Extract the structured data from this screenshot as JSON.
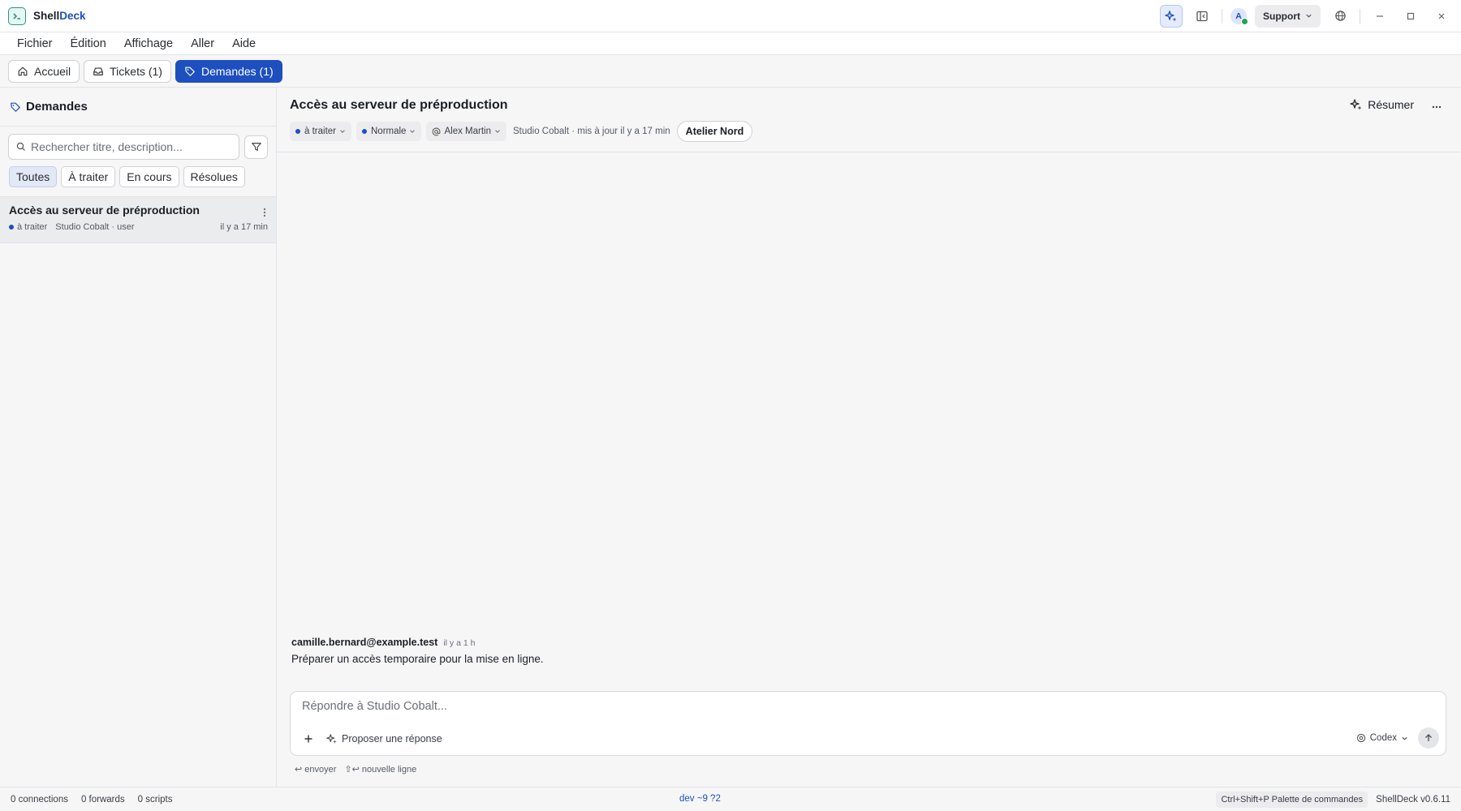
{
  "app": {
    "name_prefix": "Shell",
    "name_suffix": "Deck",
    "workspace": "Support",
    "avatar_initial": "A"
  },
  "menu": [
    "Fichier",
    "Édition",
    "Affichage",
    "Aller",
    "Aide"
  ],
  "tabs": [
    {
      "label": "Accueil",
      "icon": "home-icon"
    },
    {
      "label": "Tickets (1)",
      "icon": "inbox-icon"
    },
    {
      "label": "Demandes (1)",
      "icon": "tag-icon",
      "active": true
    }
  ],
  "sidebar": {
    "title": "Demandes",
    "search_placeholder": "Rechercher titre, description...",
    "filters": [
      "Toutes",
      "À traiter",
      "En cours",
      "Résolues"
    ],
    "active_filter": "Toutes",
    "items": [
      {
        "title": "Accès au serveur de préproduction",
        "status": "à traiter",
        "org": "Studio Cobalt · user",
        "time": "il y a 17 min"
      }
    ]
  },
  "ticket": {
    "title": "Accès au serveur de préproduction",
    "summarize_label": "Résumer",
    "status": "à traiter",
    "priority": "Normale",
    "assignee": "Alex Martin",
    "meta": "Studio Cobalt · mis à jour il y a 17 min",
    "org_button": "Atelier Nord",
    "messages": [
      {
        "author": "camille.bernard@example.test",
        "time": "il y a 1 h",
        "body": "Préparer un accès temporaire pour la mise en ligne."
      }
    ]
  },
  "composer": {
    "placeholder": "Répondre à Studio Cobalt...",
    "suggest_label": "Proposer une réponse",
    "model": "Codex",
    "hint_send": "↩ envoyer",
    "hint_newline": "⇧↩ nouvelle ligne"
  },
  "statusbar": {
    "connections": "0 connections",
    "forwards": "0 forwards",
    "scripts": "0 scripts",
    "branch": "dev ~9 ?2",
    "palette_hint": "Ctrl+Shift+P Palette de commandes",
    "version": "ShellDeck v0.6.11"
  },
  "colors": {
    "accent": "#1d4fbf",
    "brand_green": "#1f9a83",
    "online": "#22a355"
  }
}
